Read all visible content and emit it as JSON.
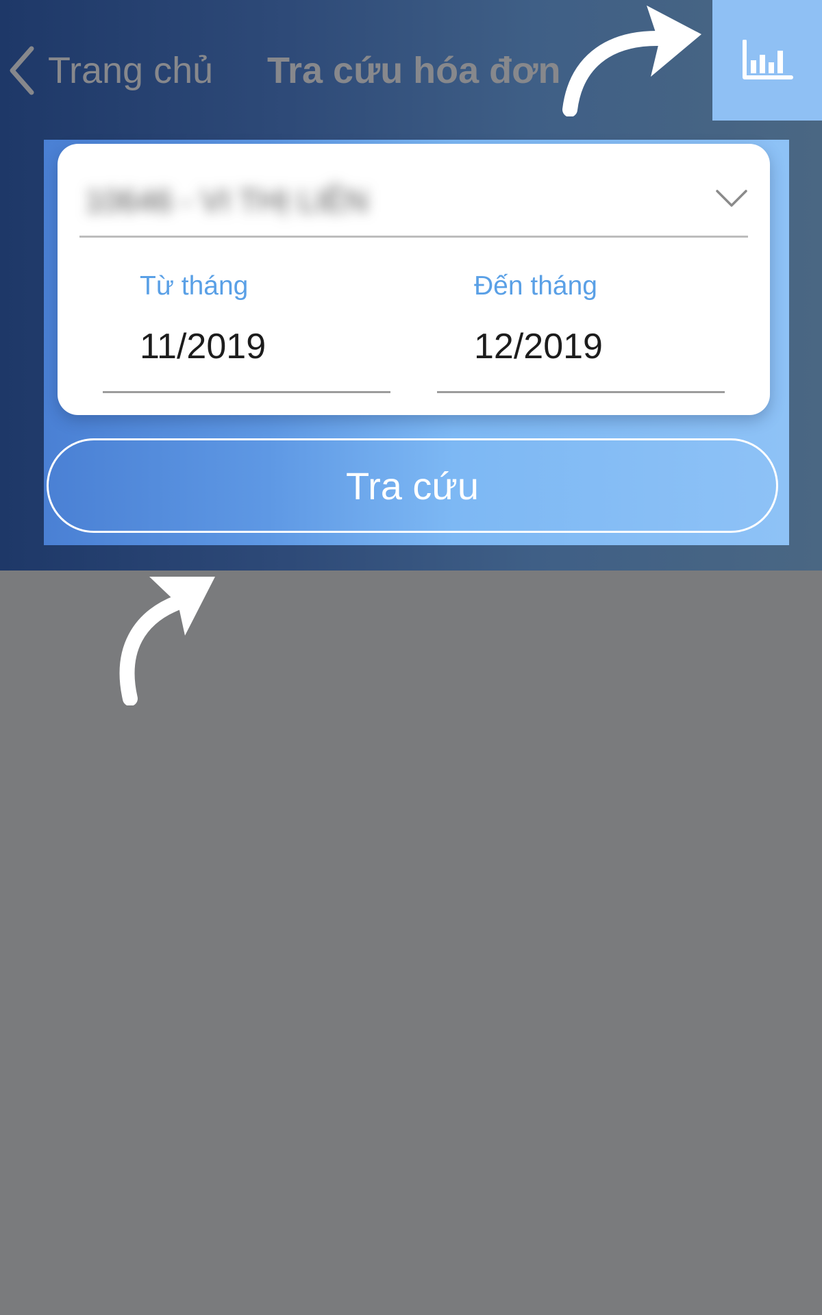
{
  "header": {
    "back_label": "Trang chủ",
    "title": "Tra cứu hóa đơn",
    "chart_button_icon": "bar-chart-icon"
  },
  "form": {
    "account_value": "10646 - VI THỊ LIÊN",
    "account_icon": "chevron-down-icon",
    "from_label": "Từ tháng",
    "from_value": "11/2019",
    "to_label": "Đến tháng",
    "to_value": "12/2019",
    "submit_label": "Tra cứu"
  },
  "annotations": {
    "arrow_icon": "hand-drawn-arrow-icon",
    "arrow_color": "#ffffff"
  },
  "colors": {
    "header_gradient_start": "#1e3868",
    "header_gradient_end": "#4a6783",
    "chart_button": "#8fc0f4",
    "panel_gradient_start": "#4a80d4",
    "panel_gradient_end": "#8ec2f6",
    "label_blue": "#5aa0e6",
    "background": "#7a7b7d"
  }
}
